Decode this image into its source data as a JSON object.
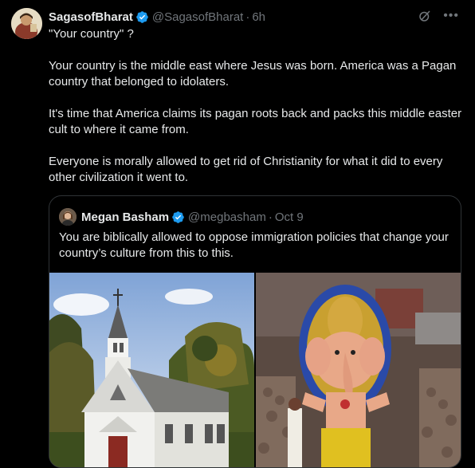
{
  "tweet": {
    "display_name": "SagasofBharat",
    "handle": "@SagasofBharat",
    "separator": "·",
    "time": "6h",
    "paragraphs": [
      "\"Your country\" ?",
      "Your country is the middle east where Jesus was born. America was a Pagan country that belonged to idolaters.",
      "It's time that America claims its pagan roots back and packs this middle easter cult to where it came from.",
      "Everyone is morally allowed to get rid of Christianity for what it did to every other civilization it went to."
    ]
  },
  "quoted": {
    "display_name": "Megan Basham",
    "handle": "@megbasham",
    "separator": "·",
    "time": "Oct 9",
    "text": "You are biblically allowed to oppose immigration policies that change your country’s culture from this to this."
  },
  "icons": [
    "verified-badge-icon",
    "grok-icon",
    "more-icon"
  ],
  "colors": {
    "background": "#000000",
    "text": "#e7e9ea",
    "muted": "#71767b",
    "verified": "#1d9bf0",
    "border": "#2f3336"
  }
}
